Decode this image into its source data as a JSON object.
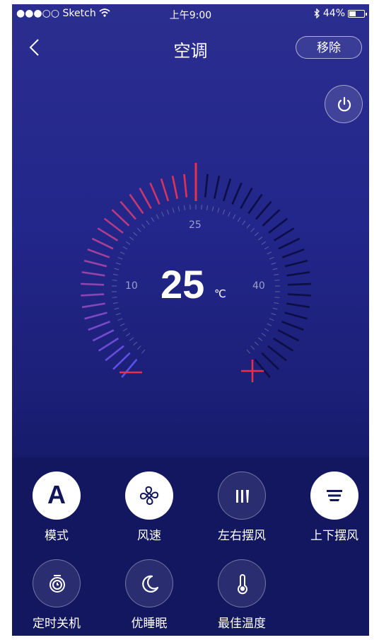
{
  "status_bar": {
    "carrier": "●●●○○ Sketch",
    "time": "上午9:00",
    "battery": "44%"
  },
  "nav": {
    "title": "空调",
    "remove_label": "移除"
  },
  "thermostat": {
    "temperature": "25",
    "unit": "℃",
    "min_label": "10",
    "mid_label": "25",
    "max_label": "40",
    "level": 25
  },
  "controls": [
    {
      "label": "模式",
      "icon": "mode-a-icon",
      "active": true,
      "glyph": "A"
    },
    {
      "label": "风速",
      "icon": "fan-icon",
      "active": true
    },
    {
      "label": "左右摆风",
      "icon": "horizontal-swing-icon",
      "active": false
    },
    {
      "label": "上下摆风",
      "icon": "vertical-swing-icon",
      "active": true
    },
    {
      "label": "定时关机",
      "icon": "timer-icon",
      "active": false
    },
    {
      "label": "优睡眠",
      "icon": "moon-icon",
      "active": false
    },
    {
      "label": "最佳温度",
      "icon": "thermometer-icon",
      "active": false
    }
  ],
  "colors": {
    "accent": "#e8304a",
    "background": "#23268a",
    "panel": "#121760"
  }
}
